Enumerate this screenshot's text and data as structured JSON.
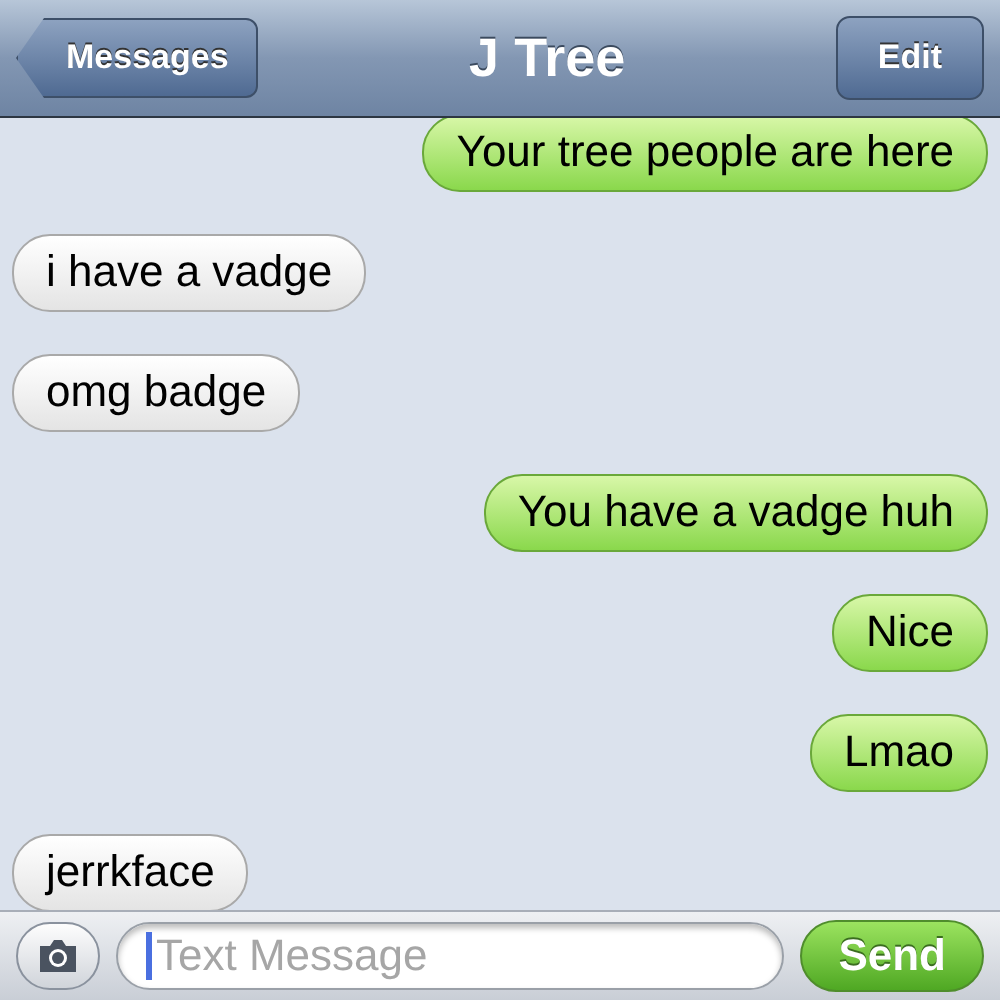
{
  "nav": {
    "back": "Messages",
    "title": "J Tree",
    "action": "Edit"
  },
  "messages": [
    {
      "kind": "sent",
      "text": "Your tree people are here"
    },
    {
      "kind": "received",
      "text": "i have a vadge"
    },
    {
      "kind": "received",
      "text": "omg badge"
    },
    {
      "kind": "sent",
      "text": "You have a vadge huh"
    },
    {
      "kind": "sent",
      "text": "Nice"
    },
    {
      "kind": "sent",
      "text": "Lmao"
    },
    {
      "kind": "received",
      "text": "jerrkface"
    }
  ],
  "composer": {
    "placeholder": "Text Message",
    "send": "Send"
  }
}
